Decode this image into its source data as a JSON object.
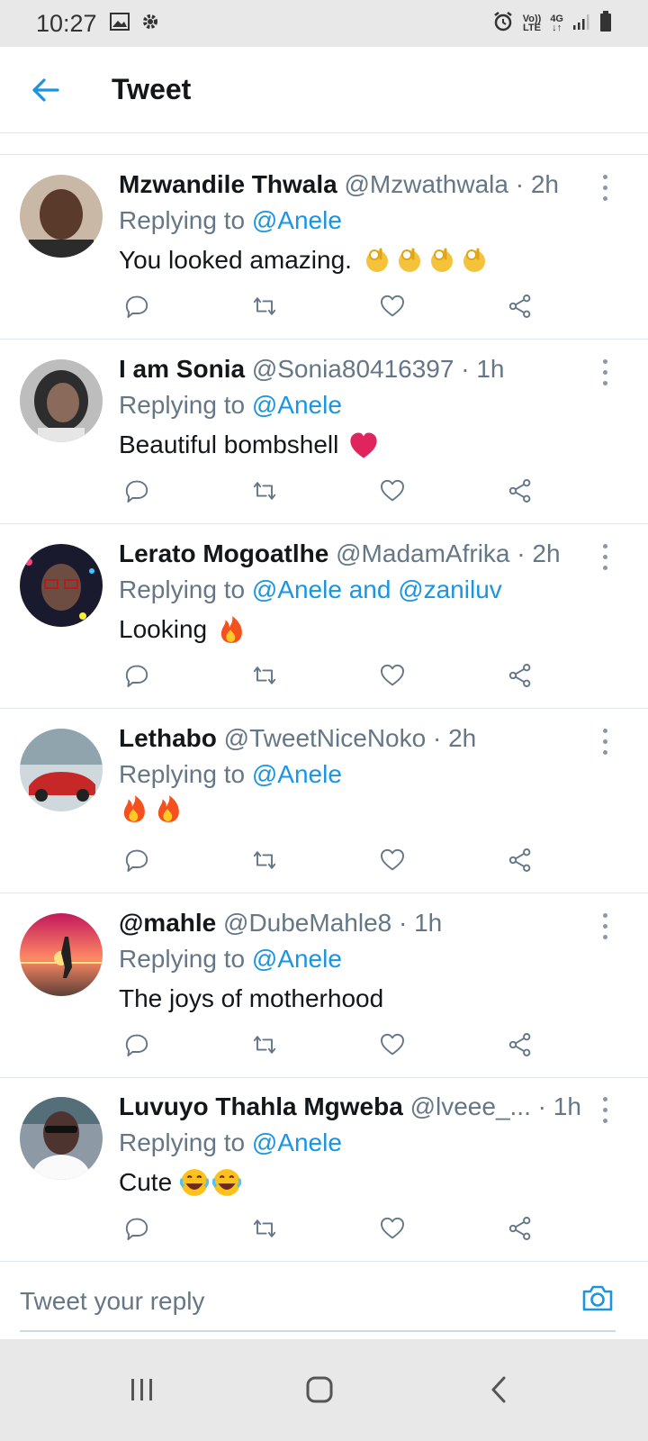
{
  "status_bar": {
    "time": "10:27",
    "volte": [
      "Vo))",
      "LTE"
    ],
    "network": [
      "4G",
      "↓↑"
    ]
  },
  "header": {
    "title": "Tweet"
  },
  "tweets": [
    {
      "name": "Mzwandile Thwala",
      "handle": "@Mzwathwala",
      "time": "· 2h",
      "replying_prefix": "Replying to ",
      "replying_to": "@Anele",
      "text": "You looked amazing.",
      "emoji": "ok-hand-icon",
      "emoji_count": 4
    },
    {
      "name": "I am Sonia",
      "handle": "@Sonia80416397",
      "time": "· 1h",
      "replying_prefix": "Replying to ",
      "replying_to": "@Anele",
      "text": "Beautiful bombshell",
      "emoji": "red-heart-icon",
      "emoji_count": 1
    },
    {
      "name": "Lerato Mogoatlhe",
      "handle": "@MadamAfrika",
      "time": "· 2h",
      "replying_prefix": "Replying to ",
      "replying_to": "@Anele and @zaniluv",
      "text": "Looking",
      "emoji": "fire-icon",
      "emoji_count": 1
    },
    {
      "name": "Lethabo",
      "handle": "@TweetNiceNoko",
      "time": "· 2h",
      "replying_prefix": "Replying to ",
      "replying_to": "@Anele",
      "text": "",
      "emoji": "fire-icon",
      "emoji_count": 2
    },
    {
      "name": "@mahle",
      "handle": "@DubeMahle8",
      "time": "· 1h",
      "replying_prefix": "Replying to ",
      "replying_to": "@Anele",
      "text": "The joys of motherhood",
      "emoji": "",
      "emoji_count": 0
    },
    {
      "name": "Luvuyo Thahla Mgweba",
      "handle": "@lveee_...",
      "time": "· 1h",
      "replying_prefix": "Replying to ",
      "replying_to": "@Anele",
      "text": "Cute",
      "emoji": "tears-of-joy-icon",
      "emoji_count": 2
    }
  ],
  "reply_bar": {
    "placeholder": "Tweet your reply"
  },
  "colors": {
    "accent": "#1b95e0",
    "muted": "#657786",
    "text": "#14171a",
    "divider": "#e1e8ed"
  }
}
